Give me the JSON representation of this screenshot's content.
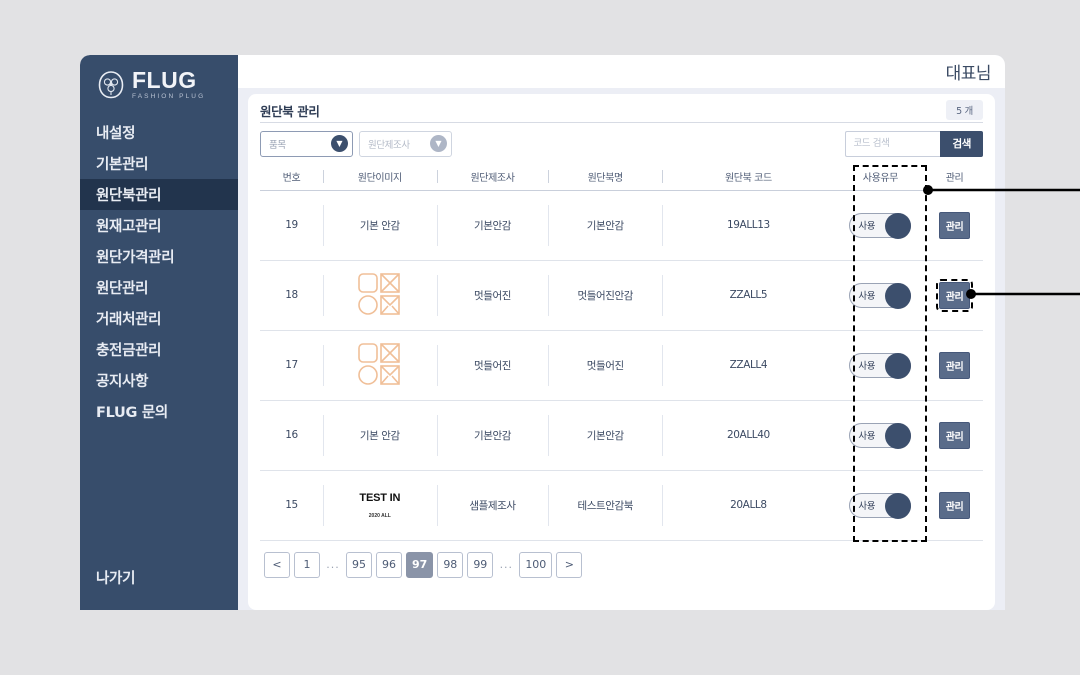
{
  "brand": {
    "name": "FLUG",
    "tagline": "FASHION PLUG",
    "logo_icon": "flug-emblem-icon"
  },
  "sidebar": {
    "items": [
      {
        "label": "내설정",
        "active": false
      },
      {
        "label": "기본관리",
        "active": false
      },
      {
        "label": "원단북관리",
        "active": true
      },
      {
        "label": "원재고관리",
        "active": false
      },
      {
        "label": "원단가격관리",
        "active": false
      },
      {
        "label": "원단관리",
        "active": false
      },
      {
        "label": "거래처관리",
        "active": false
      },
      {
        "label": "충전금관리",
        "active": false
      },
      {
        "label": "공지사항",
        "active": false
      },
      {
        "label": "FLUG 문의",
        "active": false
      }
    ],
    "logout_label": "나가기"
  },
  "topbar": {
    "user_label": "대표님"
  },
  "panel": {
    "title": "원단북 관리",
    "count_badge": "5 개"
  },
  "filters": {
    "item_select": {
      "label": "품목",
      "icon": "chevron-down-icon"
    },
    "maker_select": {
      "label": "원단제조사",
      "icon": "chevron-down-icon"
    },
    "search_placeholder": "코드 검색",
    "search_value": "",
    "search_button": "검색"
  },
  "table": {
    "columns": [
      "번호",
      "원단이미지",
      "원단제조사",
      "원단북명",
      "원단북 코드",
      "사용유무",
      "관리"
    ],
    "rows": [
      {
        "no": "19",
        "image_type": "text",
        "image_text": "기본 안감",
        "image_sub": "",
        "maker": "기본안감",
        "book_name": "기본안감",
        "code": "19ALL13",
        "toggle_label": "사용",
        "toggle_on": true,
        "manage_label": "관리",
        "manage_highlight": false
      },
      {
        "no": "18",
        "image_type": "placeholder",
        "image_text": "",
        "image_sub": "",
        "maker": "멋들어진",
        "book_name": "멋들어진안감",
        "code": "ZZALL5",
        "toggle_label": "사용",
        "toggle_on": true,
        "manage_label": "관리",
        "manage_highlight": true
      },
      {
        "no": "17",
        "image_type": "placeholder",
        "image_text": "",
        "image_sub": "",
        "maker": "멋들어진",
        "book_name": "멋들어진",
        "code": "ZZALL4",
        "toggle_label": "사용",
        "toggle_on": true,
        "manage_label": "관리",
        "manage_highlight": false
      },
      {
        "no": "16",
        "image_type": "text",
        "image_text": "기본 안감",
        "image_sub": "",
        "maker": "기본안감",
        "book_name": "기본안감",
        "code": "20ALL40",
        "toggle_label": "사용",
        "toggle_on": true,
        "manage_label": "관리",
        "manage_highlight": false
      },
      {
        "no": "15",
        "image_type": "test",
        "image_text": "TEST IN",
        "image_sub": "2020 ALL",
        "maker": "샘플제조사",
        "book_name": "테스트안감북",
        "code": "20ALL8",
        "toggle_label": "사용",
        "toggle_on": true,
        "manage_label": "관리",
        "manage_highlight": false
      }
    ]
  },
  "pagination": {
    "prev": "<",
    "next": ">",
    "first": "1",
    "ellipsis": "...",
    "pages": [
      "95",
      "96",
      "97",
      "98",
      "99"
    ],
    "last": "100",
    "current": "97"
  },
  "colors": {
    "sidebar_bg": "#374d6b",
    "sidebar_active_bg": "#22344d",
    "accent": "#3c4f6d",
    "page_bg": "#e2e2e4",
    "panel_bg": "#ffffff",
    "placeholder_icon": "#f0c09a",
    "pager_active_bg": "#8a94a8"
  }
}
